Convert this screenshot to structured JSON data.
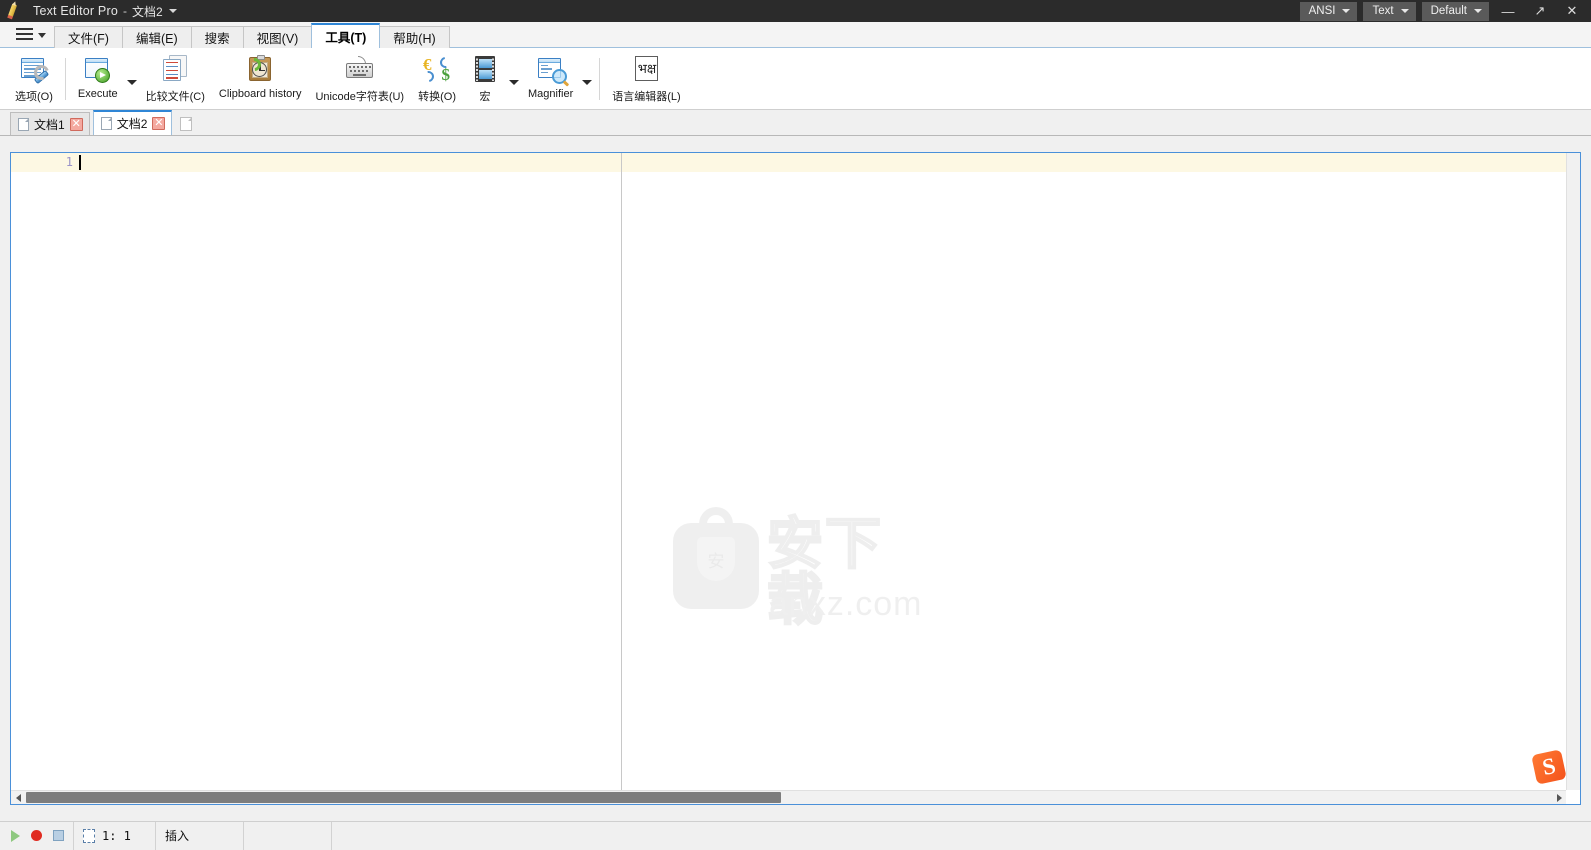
{
  "titlebar": {
    "app_icon": "pencil-icon",
    "app_name": "Text Editor Pro",
    "separator": "-",
    "document": "文档2",
    "chips": [
      {
        "label": "ANSI",
        "name": "encoding-dropdown"
      },
      {
        "label": "Text",
        "name": "language-dropdown"
      },
      {
        "label": "Default",
        "name": "scheme-dropdown"
      }
    ],
    "window_controls": {
      "minimize": "—",
      "maximize": "↗",
      "close": "✕"
    },
    "bg_color": "#2b2b2b"
  },
  "menubar": {
    "hamburger": "menu-icon",
    "tabs": [
      {
        "label": "文件(F)",
        "name": "tab-file",
        "active": false
      },
      {
        "label": "编辑(E)",
        "name": "tab-edit",
        "active": false
      },
      {
        "label": "搜索",
        "name": "tab-search",
        "active": false
      },
      {
        "label": "视图(V)",
        "name": "tab-view",
        "active": false
      },
      {
        "label": "工具(T)",
        "name": "tab-tools",
        "active": true
      },
      {
        "label": "帮助(H)",
        "name": "tab-help",
        "active": false
      }
    ],
    "active_accent": "#2f86d6"
  },
  "toolbar": {
    "buttons": [
      {
        "label": "选项(O)",
        "icon": "options-wrench-icon"
      },
      {
        "label": "Execute",
        "icon": "execute-play-icon",
        "has_dropdown": true
      },
      {
        "label": "比较文件(C)",
        "icon": "compare-files-icon"
      },
      {
        "label": "Clipboard history",
        "icon": "clipboard-history-icon"
      },
      {
        "label": "Unicode字符表(U)",
        "icon": "keyboard-unicode-icon"
      },
      {
        "label": "转换(O)",
        "icon": "convert-currency-icon"
      },
      {
        "label": "宏",
        "icon": "macro-film-icon",
        "has_dropdown": true
      },
      {
        "label": "Magnifier",
        "icon": "magnifier-icon",
        "has_dropdown": true
      },
      {
        "label": "语言编辑器(L)",
        "icon": "language-editor-icon"
      }
    ]
  },
  "doctabs": {
    "tabs": [
      {
        "label": "文档1",
        "name": "doc-tab-1",
        "active": false,
        "close": "✕"
      },
      {
        "label": "文档2",
        "name": "doc-tab-2",
        "active": true,
        "close": "✕"
      }
    ],
    "new_tab_icon": "new-document-icon"
  },
  "editor": {
    "line_number": "1",
    "content": "",
    "current_line_color": "#fdf8e3",
    "focus_border_color": "#4a90d9",
    "margin_guide_x": "610"
  },
  "watermark": {
    "shield_char": "安",
    "chinese_text": "安下载",
    "url_text": "anxz.com"
  },
  "ime": {
    "logo": "S",
    "name": "sogou-ime-icon"
  },
  "scrollbars": {
    "h_left_arrow": "◀",
    "h_right_arrow": "▶",
    "h_thumb_percent": "50"
  },
  "statusbar": {
    "macro_play": "play-macro-icon",
    "macro_record": "record-macro-icon",
    "macro_stop": "stop-macro-icon",
    "position_icon": "caret-position-icon",
    "position": "1: 1",
    "insert_mode": "插入",
    "cell4": "",
    "cell5": ""
  }
}
